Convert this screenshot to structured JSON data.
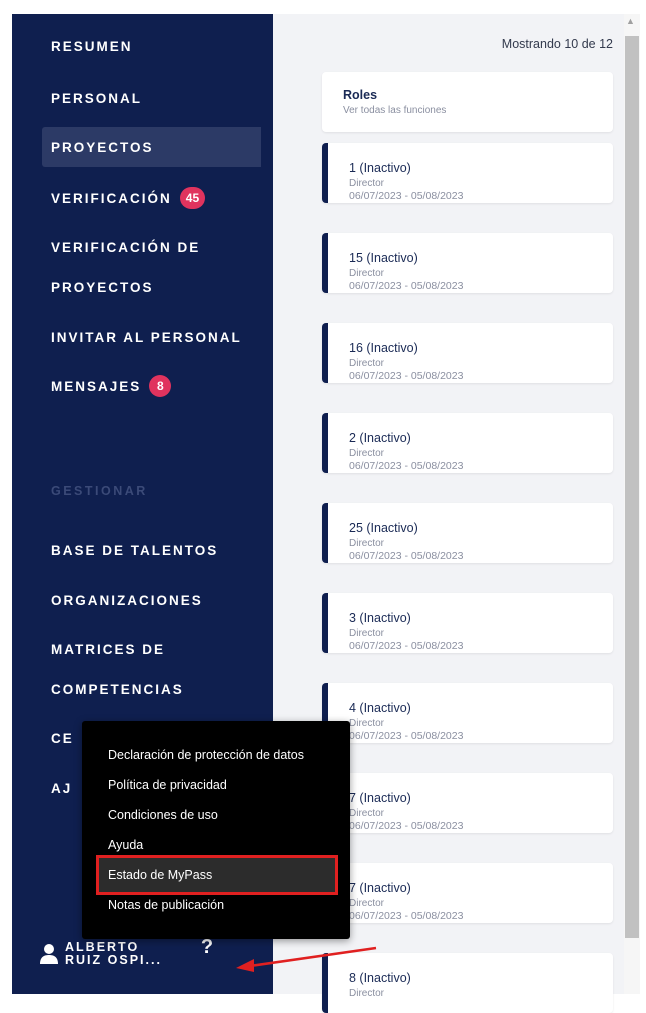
{
  "sidebar": {
    "items": [
      {
        "label": "RESUMEN"
      },
      {
        "label": "PERSONAL"
      },
      {
        "label": "PROYECTOS"
      },
      {
        "label": "VERIFICACIÓN",
        "badge": "45"
      },
      {
        "label": "VERIFICACIÓN DE"
      },
      {
        "label": "PROYECTOS"
      },
      {
        "label": "INVITAR AL PERSONAL"
      },
      {
        "label": "MENSAJES",
        "badge": "8"
      }
    ],
    "section_label": "GESTIONAR",
    "manage_items": [
      {
        "label": "BASE DE TALENTOS"
      },
      {
        "label": "ORGANIZACIONES"
      },
      {
        "label": "MATRICES DE"
      },
      {
        "label": "COMPETENCIAS"
      },
      {
        "label": "CE"
      },
      {
        "label": "AJ"
      }
    ],
    "user": {
      "first": "ALBERTO",
      "last": "RUIZ OSPI..."
    },
    "help_label": "?"
  },
  "main": {
    "showing_text": "Mostrando 10 de 12",
    "roles_card": {
      "title": "Roles",
      "subtitle": "Ver todas las funciones"
    },
    "projects": [
      {
        "title": "1 (Inactivo)",
        "role": "Director",
        "dates": "06/07/2023 - 05/08/2023"
      },
      {
        "title": "15 (Inactivo)",
        "role": "Director",
        "dates": "06/07/2023 - 05/08/2023"
      },
      {
        "title": "16 (Inactivo)",
        "role": "Director",
        "dates": "06/07/2023 - 05/08/2023"
      },
      {
        "title": "2 (Inactivo)",
        "role": "Director",
        "dates": "06/07/2023 - 05/08/2023"
      },
      {
        "title": "25 (Inactivo)",
        "role": "Director",
        "dates": "06/07/2023 - 05/08/2023"
      },
      {
        "title": "3 (Inactivo)",
        "role": "Director",
        "dates": "06/07/2023 - 05/08/2023"
      },
      {
        "title": "4 (Inactivo)",
        "role": "Director",
        "dates": "06/07/2023 - 05/08/2023"
      },
      {
        "title": "7 (Inactivo)",
        "role": "Director",
        "dates": "06/07/2023 - 05/08/2023"
      },
      {
        "title": "7 (Inactivo)",
        "role": "Director",
        "dates": "06/07/2023 - 05/08/2023"
      },
      {
        "title": "8 (Inactivo)",
        "role": "Director",
        "dates": ""
      }
    ]
  },
  "help_menu": {
    "items": [
      {
        "label": "Declaración de protección de datos"
      },
      {
        "label": "Política de privacidad"
      },
      {
        "label": "Condiciones de uso"
      },
      {
        "label": "Ayuda"
      },
      {
        "label": "Estado de MyPass"
      },
      {
        "label": "Notas de publicación"
      }
    ]
  },
  "colors": {
    "sidebar_bg": "#0f1f4f",
    "badge": "#e0335e",
    "highlight_border": "#e02020",
    "annotation_arrow": "#e02020"
  }
}
